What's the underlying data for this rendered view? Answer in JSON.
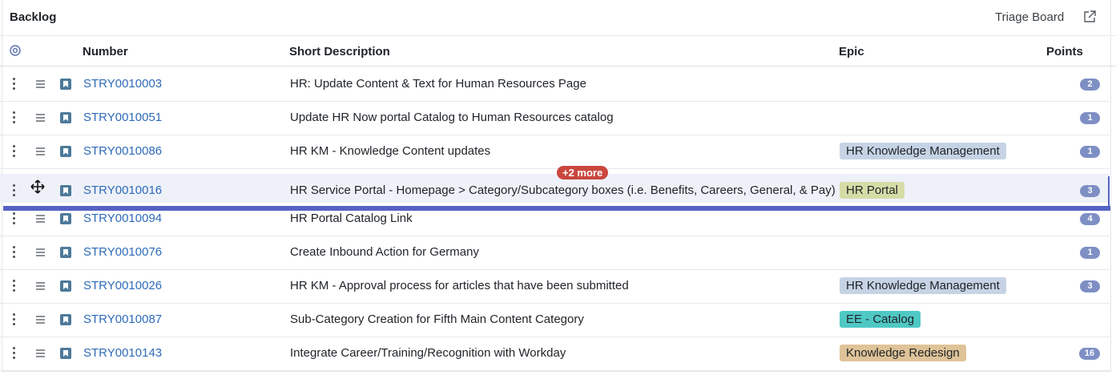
{
  "header": {
    "title": "Backlog",
    "triage_label": "Triage Board",
    "open_icon": "external-link-icon"
  },
  "columns": {
    "settings_icon": "gear-icon",
    "number": "Number",
    "short_description": "Short Description",
    "epic": "Epic",
    "points": "Points"
  },
  "drag_badge": "+2 more",
  "colors": {
    "link": "#2e6bb8",
    "points_badge": "#7e8fc4",
    "drop_indicator": "#5562c4",
    "more_badge": "#c9473e",
    "epic_hr_km": "#c6d3e5",
    "epic_hr_portal": "#d6dca6",
    "epic_ee_catalog": "#4fc8c4",
    "epic_knowledge_redesign": "#dfc398"
  },
  "rows": [
    {
      "number": "STRY0010003",
      "description": "HR: Update Content & Text for Human Resources Page",
      "epic": "",
      "points": "2"
    },
    {
      "number": "STRY0010051",
      "description": "Update HR Now portal Catalog to Human Resources catalog",
      "epic": "",
      "points": "1"
    },
    {
      "number": "STRY0010086",
      "description": "HR KM - Knowledge Content updates",
      "epic": "HR Knowledge Management",
      "points": "1"
    },
    {
      "number": "STRY0010016",
      "description": "HR Service Portal - Homepage > Category/Subcategory boxes (i.e. Benefits, Careers, General, & Pay)",
      "epic": "HR Portal",
      "points": "3"
    },
    {
      "number": "STRY0010094",
      "description": "HR Portal Catalog Link",
      "epic": "",
      "points": "4"
    },
    {
      "number": "STRY0010076",
      "description": "Create Inbound Action for Germany",
      "epic": "",
      "points": "1"
    },
    {
      "number": "STRY0010026",
      "description": "HR KM - Approval process for articles that have been submitted",
      "epic": "HR Knowledge Management",
      "points": "3"
    },
    {
      "number": "STRY0010087",
      "description": "Sub-Category Creation for Fifth Main Content Category",
      "epic": "EE - Catalog",
      "points": ""
    },
    {
      "number": "STRY0010143",
      "description": "Integrate Career/Training/Recognition with Workday",
      "epic": "Knowledge Redesign",
      "points": "16"
    }
  ]
}
